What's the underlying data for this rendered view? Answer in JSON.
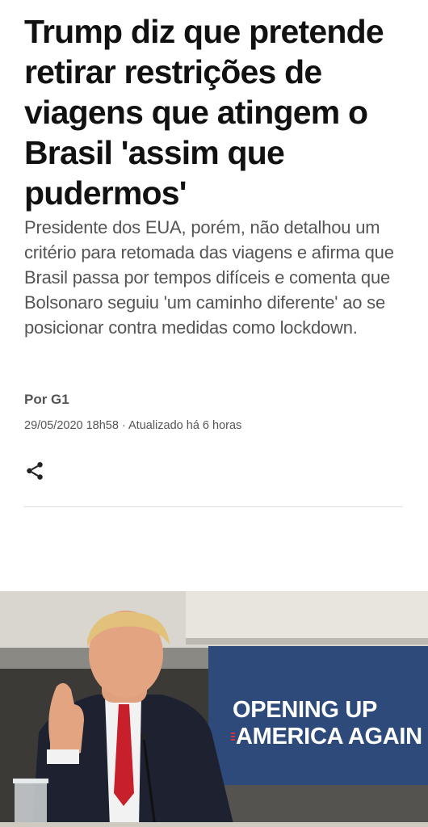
{
  "article": {
    "headline": "Trump diz que pretende retirar restrições de viagens que atingem o Brasil 'assim que pudermos'",
    "subtitle": "Presidente dos EUA, porém, não detalhou um critério para retomada das viagens e afirma que Brasil passa por tempos difíceis e comenta que Bolsonaro seguiu 'um caminho diferente' ao se posicionar contra medidas como lockdown.",
    "byline": "Por G1",
    "dateline": "29/05/2020 18h58 · Atualizado há 6 horas",
    "share_icon": "share-icon"
  },
  "photo": {
    "sign_line1": "OPENING UP",
    "sign_line2": "AMERICA AGAIN",
    "sign_color": "#2d4a7a"
  }
}
